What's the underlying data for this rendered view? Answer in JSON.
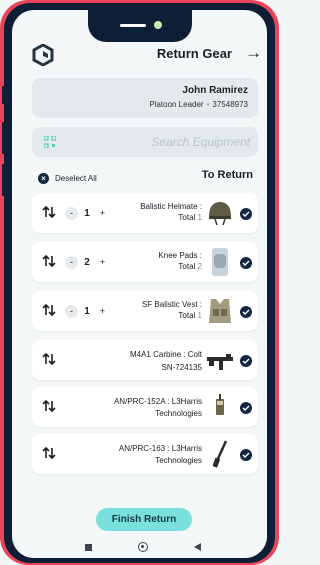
{
  "header": {
    "title": "Return Gear",
    "arrow_icon": "arrow-right-icon"
  },
  "user": {
    "name": "John Ramirez",
    "role": "Platoon Leader",
    "id": "37548973"
  },
  "search": {
    "placeholder": "Search Equipment"
  },
  "list_header": {
    "deselect_label": "Deselect All",
    "section_title": "To Return"
  },
  "items": [
    {
      "name": "Balistic Helmate :",
      "total_label": "Total",
      "total": "1",
      "qty": "1",
      "has_stepper": true,
      "selected": true,
      "image": "helmet-image"
    },
    {
      "name": "Knee Pads :",
      "total_label": "Total",
      "total": "2",
      "qty": "2",
      "has_stepper": true,
      "selected": true,
      "image": "knee-pads-image"
    },
    {
      "name": "SF Balistic Vest :",
      "total_label": "Total",
      "total": "1",
      "qty": "1",
      "has_stepper": true,
      "selected": true,
      "image": "vest-image"
    },
    {
      "line1": "M4A1 Carbine : Colt",
      "line2": "SN-724135",
      "has_stepper": false,
      "selected": true,
      "image": "rifle-image"
    },
    {
      "line1": "AN/PRC-152A : L3Harris",
      "line2": "Technologies",
      "has_stepper": false,
      "selected": true,
      "image": "radio-image"
    },
    {
      "line1": "AN/PRC-163 : L3Harris",
      "line2": "Technologies",
      "has_stepper": false,
      "selected": true,
      "image": "handheld-radio-image"
    }
  ],
  "stepper": {
    "minus": "-",
    "plus": "+"
  },
  "footer": {
    "finish_label": "Finish Return"
  },
  "colors": {
    "frame": "#e9445a",
    "dark": "#0d1e35",
    "accent": "#79e0dc",
    "card": "#e3e9ec",
    "qr_icon": "#4fd1b5"
  }
}
